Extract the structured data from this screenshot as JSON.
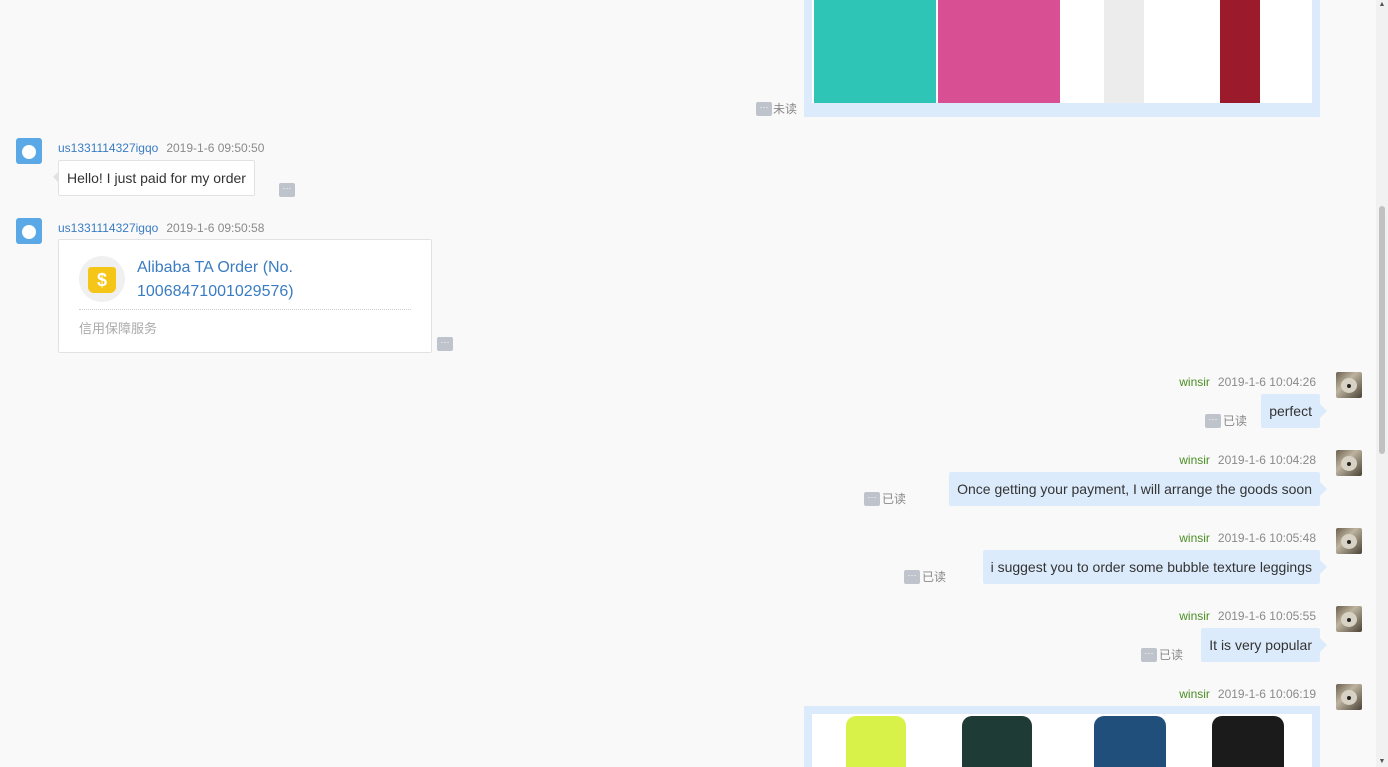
{
  "messages": [
    {
      "sender": "us1331114327igqo",
      "time": "2019-1-6 09:50:50",
      "text": "Hello! I just paid for my order"
    },
    {
      "sender": "us1331114327igqo",
      "time": "2019-1-6 09:50:58",
      "order_card": {
        "title_line1": "Alibaba TA Order (No.",
        "title_line2": "10068471001029576)",
        "subtitle": "信用保障服务",
        "icon": "money-bag-icon"
      }
    },
    {
      "sender": "winsir",
      "time": "2019-1-6 10:04:26",
      "text": "perfect",
      "status": "已读"
    },
    {
      "sender": "winsir",
      "time": "2019-1-6 10:04:28",
      "text": "Once getting your payment, I will arrange the goods soon",
      "status": "已读"
    },
    {
      "sender": "winsir",
      "time": "2019-1-6 10:05:48",
      "text": "i suggest you to order some bubble texture leggings",
      "status": "已读"
    },
    {
      "sender": "winsir",
      "time": "2019-1-6 10:05:55",
      "text": "It is very popular",
      "status": "已读"
    },
    {
      "sender": "winsir",
      "time": "2019-1-6 10:06:19",
      "image": "leggings-photo-lineup"
    }
  ],
  "top_image": {
    "status": "未读",
    "colors": [
      "#2ec4b6",
      "#d94f93",
      "#f2f2f2",
      "#9b1b2c"
    ]
  },
  "bottom_image": {
    "colors": [
      "#d9f24a",
      "#1e3b35",
      "#1f4f7a",
      "#1b1b1b"
    ]
  },
  "more_glyph": "···",
  "colors": {
    "buyer_name": "#3a7cc2",
    "seller_name": "#4b8e23",
    "outgoing_bubble": "#dcebfb",
    "incoming_bubble": "#ffffff"
  }
}
